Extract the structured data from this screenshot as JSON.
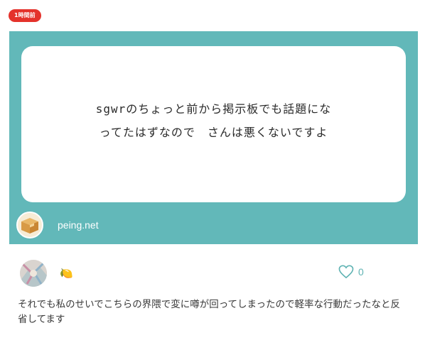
{
  "time_badge": "1時間前",
  "question": {
    "line1": "sgwrのちょっと前から掲示板でも話題にな",
    "line2": "ってたはずなので　さんは悪くないですよ"
  },
  "card_footer": {
    "site": "peing.net",
    "icon": "cardboard-box-icon"
  },
  "answer": {
    "user_badge": "🍋",
    "like_icon": "heart-outline-icon",
    "like_count": "0",
    "text": "それでも私のせいでこちらの界隈で変に噂が回ってしまったので軽率な行動だったなと反省してます"
  },
  "colors": {
    "accent": "#62b8b9",
    "badge": "#e4322b",
    "like": "#5fb3b3"
  }
}
